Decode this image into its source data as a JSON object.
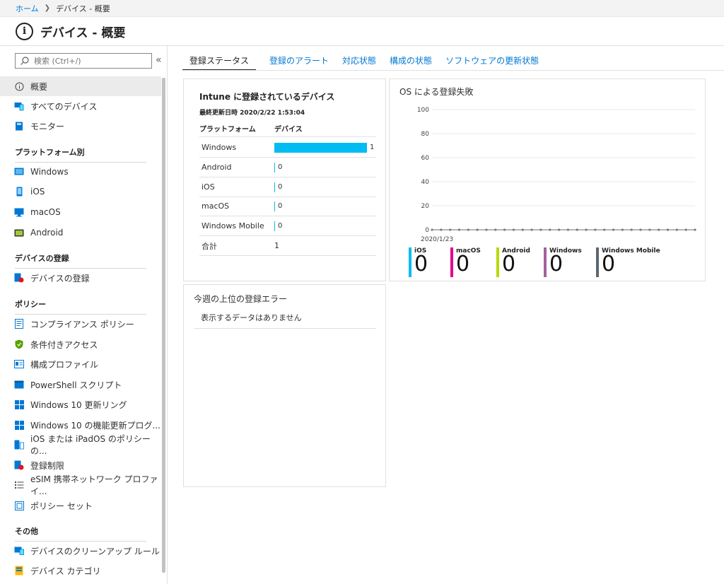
{
  "breadcrumb": {
    "home": "ホーム",
    "current": "デバイス - 概要"
  },
  "page": {
    "title": "デバイス - 概要"
  },
  "search": {
    "placeholder": "検索 (Ctrl+/)"
  },
  "sidebar": {
    "items": [
      {
        "label": "概要",
        "icon": "info-icon"
      },
      {
        "label": "すべてのデバイス",
        "icon": "devices-icon"
      },
      {
        "label": "モニター",
        "icon": "monitor-book-icon"
      }
    ],
    "sections": [
      {
        "title": "プラットフォーム別",
        "items": [
          {
            "label": "Windows",
            "icon": "windows-device-icon"
          },
          {
            "label": "iOS",
            "icon": "phone-icon"
          },
          {
            "label": "macOS",
            "icon": "desktop-icon"
          },
          {
            "label": "Android",
            "icon": "android-device-icon"
          }
        ]
      },
      {
        "title": "デバイスの登録",
        "items": [
          {
            "label": "デバイスの登録",
            "icon": "enroll-icon"
          }
        ]
      },
      {
        "title": "ポリシー",
        "items": [
          {
            "label": "コンプライアンス ポリシー",
            "icon": "compliance-icon"
          },
          {
            "label": "条件付きアクセス",
            "icon": "shield-icon"
          },
          {
            "label": "構成プロファイル",
            "icon": "profile-icon"
          },
          {
            "label": "PowerShell スクリプト",
            "icon": "powershell-icon"
          },
          {
            "label": "Windows 10 更新リング",
            "icon": "windows-logo-icon"
          },
          {
            "label": "Windows 10 の機能更新プログ...",
            "icon": "windows-logo-icon"
          },
          {
            "label": "iOS または iPadOS のポリシーの...",
            "icon": "ios-policy-icon"
          },
          {
            "label": "登録制限",
            "icon": "restriction-icon"
          },
          {
            "label": "eSIM 携帯ネットワーク プロファイ...",
            "icon": "list-icon"
          },
          {
            "label": "ポリシー セット",
            "icon": "policy-set-icon"
          }
        ]
      },
      {
        "title": "その他",
        "items": [
          {
            "label": "デバイスのクリーンアップ ルール",
            "icon": "cleanup-icon"
          },
          {
            "label": "デバイス カテゴリ",
            "icon": "category-icon"
          }
        ]
      }
    ]
  },
  "tabs": [
    {
      "label": "登録ステータス",
      "active": true
    },
    {
      "label": "登録のアラート",
      "active": false
    },
    {
      "label": "対応状態",
      "active": false
    },
    {
      "label": "構成の状態",
      "active": false
    },
    {
      "label": "ソフトウェアの更新状態",
      "active": false
    }
  ],
  "enrolled": {
    "title": "Intune に登録されているデバイス",
    "updated": "最終更新日時 2020/2/22 1:53:04",
    "col_platform": "プラットフォーム",
    "col_devices": "デバイス",
    "rows": [
      {
        "name": "Windows",
        "count": "1",
        "value": 1
      },
      {
        "name": "Android",
        "count": "0",
        "value": 0
      },
      {
        "name": "iOS",
        "count": "0",
        "value": 0
      },
      {
        "name": "macOS",
        "count": "0",
        "value": 0
      },
      {
        "name": "Windows Mobile",
        "count": "0",
        "value": 0
      }
    ],
    "total_label": "合計",
    "total_value": "1"
  },
  "chart_data": {
    "type": "line",
    "title": "OS による登録失敗",
    "xlabel": "",
    "ylabel": "",
    "ylim": [
      0,
      100
    ],
    "y_ticks": [
      "0",
      "20",
      "40",
      "60",
      "80",
      "100"
    ],
    "x_tick_label": "2020/1/23",
    "series": [
      {
        "name": "iOS",
        "color": "#00bcf2",
        "total": "0"
      },
      {
        "name": "macOS",
        "color": "#e3008c",
        "total": "0"
      },
      {
        "name": "Android",
        "color": "#bad80a",
        "total": "0"
      },
      {
        "name": "Windows",
        "color": "#a4619e",
        "total": "0"
      },
      {
        "name": "Windows Mobile",
        "color": "#5c6770",
        "total": "0"
      }
    ],
    "points": 30,
    "values": [
      0,
      0,
      0,
      0,
      0,
      0,
      0,
      0,
      0,
      0,
      0,
      0,
      0,
      0,
      0,
      0,
      0,
      0,
      0,
      0,
      0,
      0,
      0,
      0,
      0,
      0,
      0,
      0,
      0,
      0
    ]
  },
  "errors": {
    "title": "今週の上位の登録エラー",
    "empty": "表示するデータはありません"
  }
}
